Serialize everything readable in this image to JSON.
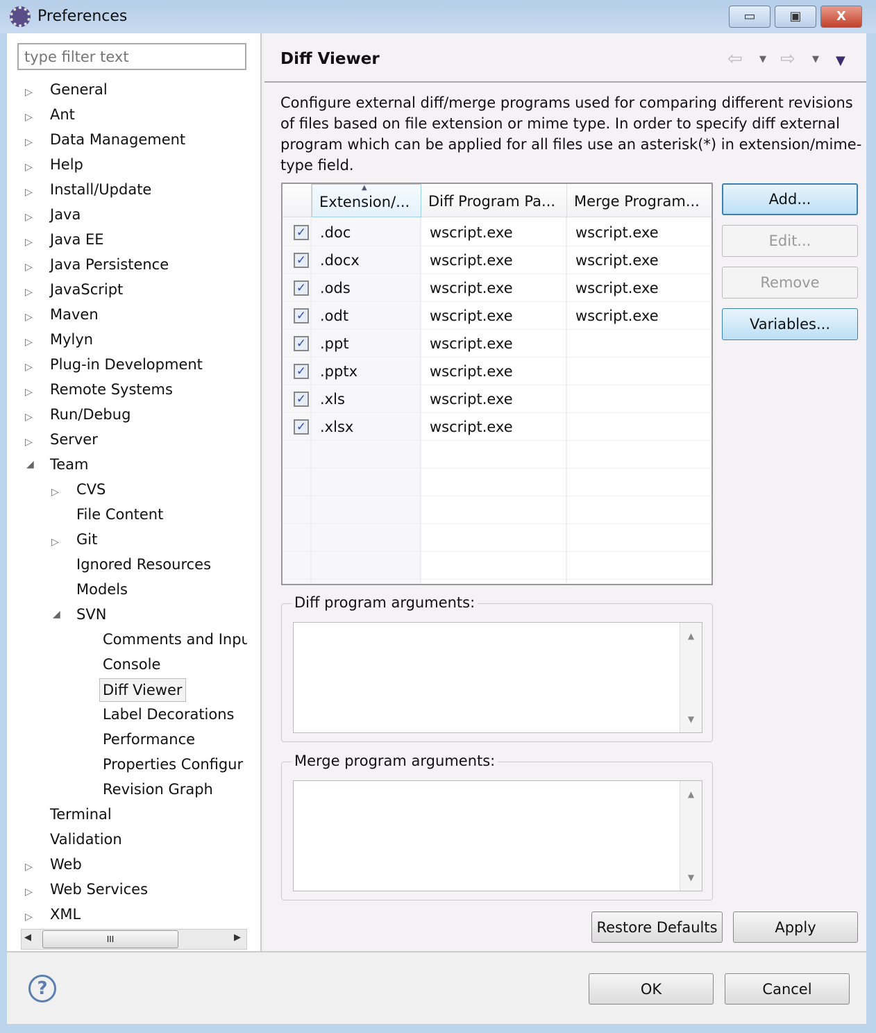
{
  "window": {
    "title": "Preferences",
    "minimize": "▭",
    "maximize": "▣",
    "close": "X"
  },
  "filter": {
    "placeholder": "type filter text"
  },
  "tree": [
    {
      "label": "General",
      "level": 0,
      "expander": "collapsed"
    },
    {
      "label": "Ant",
      "level": 0,
      "expander": "collapsed"
    },
    {
      "label": "Data Management",
      "level": 0,
      "expander": "collapsed"
    },
    {
      "label": "Help",
      "level": 0,
      "expander": "collapsed"
    },
    {
      "label": "Install/Update",
      "level": 0,
      "expander": "collapsed"
    },
    {
      "label": "Java",
      "level": 0,
      "expander": "collapsed"
    },
    {
      "label": "Java EE",
      "level": 0,
      "expander": "collapsed"
    },
    {
      "label": "Java Persistence",
      "level": 0,
      "expander": "collapsed"
    },
    {
      "label": "JavaScript",
      "level": 0,
      "expander": "collapsed"
    },
    {
      "label": "Maven",
      "level": 0,
      "expander": "collapsed"
    },
    {
      "label": "Mylyn",
      "level": 0,
      "expander": "collapsed"
    },
    {
      "label": "Plug-in Development",
      "level": 0,
      "expander": "collapsed"
    },
    {
      "label": "Remote Systems",
      "level": 0,
      "expander": "collapsed"
    },
    {
      "label": "Run/Debug",
      "level": 0,
      "expander": "collapsed"
    },
    {
      "label": "Server",
      "level": 0,
      "expander": "collapsed"
    },
    {
      "label": "Team",
      "level": 0,
      "expander": "expanded"
    },
    {
      "label": "CVS",
      "level": 1,
      "expander": "collapsed"
    },
    {
      "label": "File Content",
      "level": 1,
      "expander": "none"
    },
    {
      "label": "Git",
      "level": 1,
      "expander": "collapsed"
    },
    {
      "label": "Ignored Resources",
      "level": 1,
      "expander": "none"
    },
    {
      "label": "Models",
      "level": 1,
      "expander": "none"
    },
    {
      "label": "SVN",
      "level": 1,
      "expander": "expanded"
    },
    {
      "label": "Comments and Inpu",
      "level": 2,
      "expander": "none"
    },
    {
      "label": "Console",
      "level": 2,
      "expander": "none"
    },
    {
      "label": "Diff Viewer",
      "level": 2,
      "expander": "none",
      "selected": true
    },
    {
      "label": "Label Decorations",
      "level": 2,
      "expander": "none"
    },
    {
      "label": "Performance",
      "level": 2,
      "expander": "none"
    },
    {
      "label": "Properties Configur",
      "level": 2,
      "expander": "none"
    },
    {
      "label": "Revision Graph",
      "level": 2,
      "expander": "none"
    },
    {
      "label": "Terminal",
      "level": 0,
      "expander": "none"
    },
    {
      "label": "Validation",
      "level": 0,
      "expander": "none"
    },
    {
      "label": "Web",
      "level": 0,
      "expander": "collapsed"
    },
    {
      "label": "Web Services",
      "level": 0,
      "expander": "collapsed"
    },
    {
      "label": "XML",
      "level": 0,
      "expander": "collapsed"
    }
  ],
  "page": {
    "title": "Diff Viewer",
    "description": "Configure external diff/merge programs used for comparing different revisions of files based on file extension or mime type. In order to specify diff external program which can be applied for all files use an asterisk(*) in extension/mime-type field."
  },
  "table": {
    "columns": [
      "Extension/...",
      "Diff Program Pa...",
      "Merge Program..."
    ],
    "rows": [
      {
        "checked": true,
        "ext": ".doc",
        "diff": "wscript.exe",
        "merge": "wscript.exe"
      },
      {
        "checked": true,
        "ext": ".docx",
        "diff": "wscript.exe",
        "merge": "wscript.exe"
      },
      {
        "checked": true,
        "ext": ".ods",
        "diff": "wscript.exe",
        "merge": "wscript.exe"
      },
      {
        "checked": true,
        "ext": ".odt",
        "diff": "wscript.exe",
        "merge": "wscript.exe"
      },
      {
        "checked": true,
        "ext": ".ppt",
        "diff": "wscript.exe",
        "merge": ""
      },
      {
        "checked": true,
        "ext": ".pptx",
        "diff": "wscript.exe",
        "merge": ""
      },
      {
        "checked": true,
        "ext": ".xls",
        "diff": "wscript.exe",
        "merge": ""
      },
      {
        "checked": true,
        "ext": ".xlsx",
        "diff": "wscript.exe",
        "merge": ""
      }
    ]
  },
  "buttons": {
    "add": "Add...",
    "edit": "Edit...",
    "remove": "Remove",
    "variables": "Variables...",
    "restore": "Restore Defaults",
    "apply": "Apply",
    "ok": "OK",
    "cancel": "Cancel"
  },
  "diff_args": {
    "label": "Diff program arguments:",
    "value": ""
  },
  "merge_args": {
    "label": "Merge program arguments:",
    "value": ""
  },
  "scrollbar_grip": "III"
}
